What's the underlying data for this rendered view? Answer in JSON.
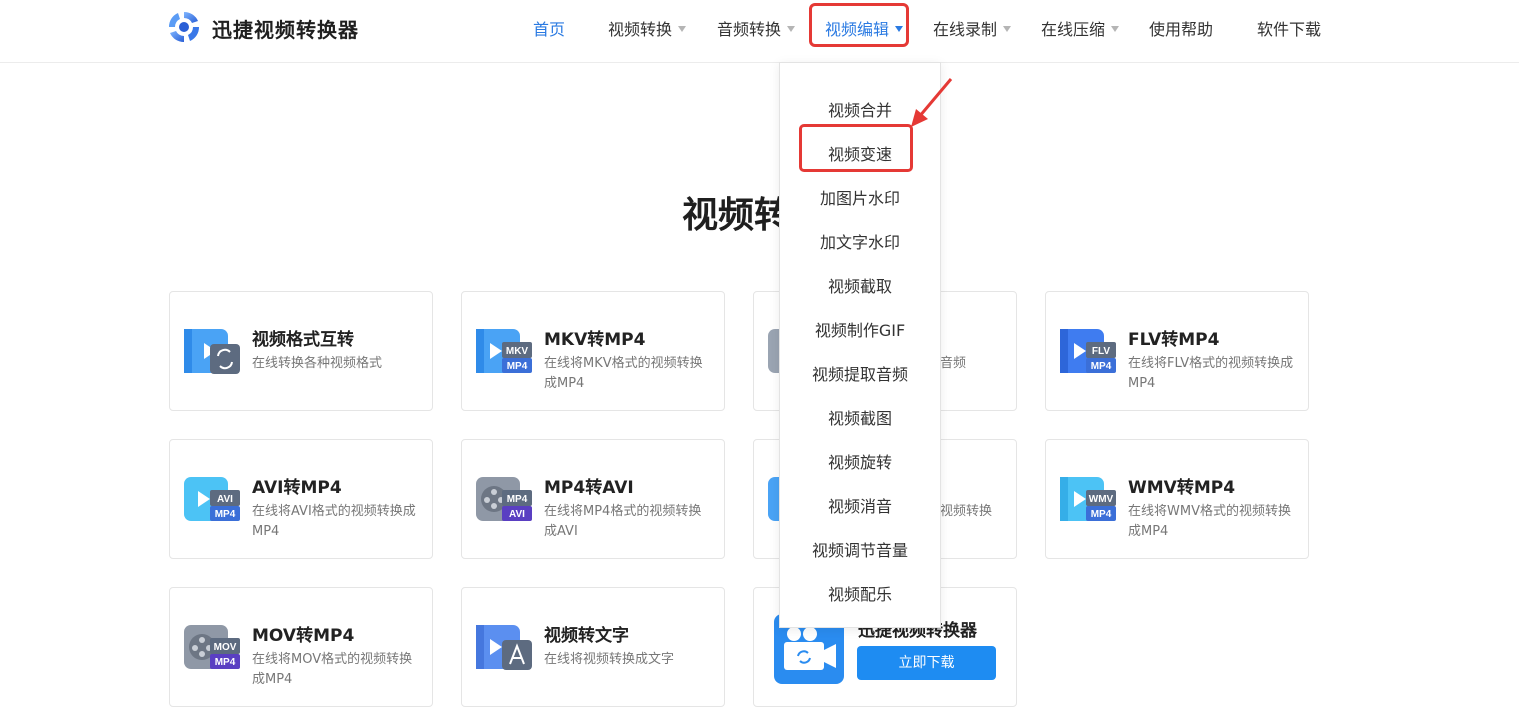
{
  "header": {
    "brand": "迅捷视频转换器",
    "nav": [
      {
        "label": "首页"
      },
      {
        "label": "视频转换"
      },
      {
        "label": "音频转换"
      },
      {
        "label": "视频编辑"
      },
      {
        "label": "在线录制"
      },
      {
        "label": "在线压缩"
      },
      {
        "label": "使用帮助"
      },
      {
        "label": "软件下载"
      }
    ]
  },
  "main": {
    "title": "视频转"
  },
  "cards": [
    {
      "title": "视频格式互转",
      "desc": "在线转换各种视频格式"
    },
    {
      "title": "MKV转MP4",
      "desc": "在线将MKV格式的视频转换成MP4",
      "badge_top": "MKV",
      "badge_bottom": "MP4"
    },
    {
      "desc": "音频"
    },
    {
      "title": "FLV转MP4",
      "desc": "在线将FLV格式的视频转换成MP4",
      "badge_top": "FLV",
      "badge_bottom": "MP4"
    },
    {
      "title": "AVI转MP4",
      "desc": "在线将AVI格式的视频转换成MP4",
      "badge_top": "AVI",
      "badge_bottom": "MP4"
    },
    {
      "title": "MP4转AVI",
      "desc": "在线将MP4格式的视频转换成AVI",
      "badge_top": "MP4",
      "badge_bottom": "AVI"
    },
    {
      "desc": "视频转换"
    },
    {
      "title": "WMV转MP4",
      "desc": "在线将WMV格式的视频转换成MP4",
      "badge_top": "WMV",
      "badge_bottom": "MP4"
    },
    {
      "title": "MOV转MP4",
      "desc": "在线将MOV格式的视频转换成MP4",
      "badge_top": "MOV",
      "badge_bottom": "MP4"
    },
    {
      "title": "视频转文字",
      "desc": "在线将视频转换成文字"
    },
    {
      "title": "迅捷视频转换器",
      "button": "立即下载"
    }
  ],
  "dropdown": {
    "items": [
      "视频合并",
      "视频变速",
      "加图片水印",
      "加文字水印",
      "视频截取",
      "视频制作GIF",
      "视频提取音频",
      "视频截图",
      "视频旋转",
      "视频消音",
      "视频调节音量",
      "视频配乐"
    ]
  },
  "colors": {
    "accent": "#2a7ae2",
    "highlight": "#e53935",
    "button": "#1e8cf2"
  }
}
